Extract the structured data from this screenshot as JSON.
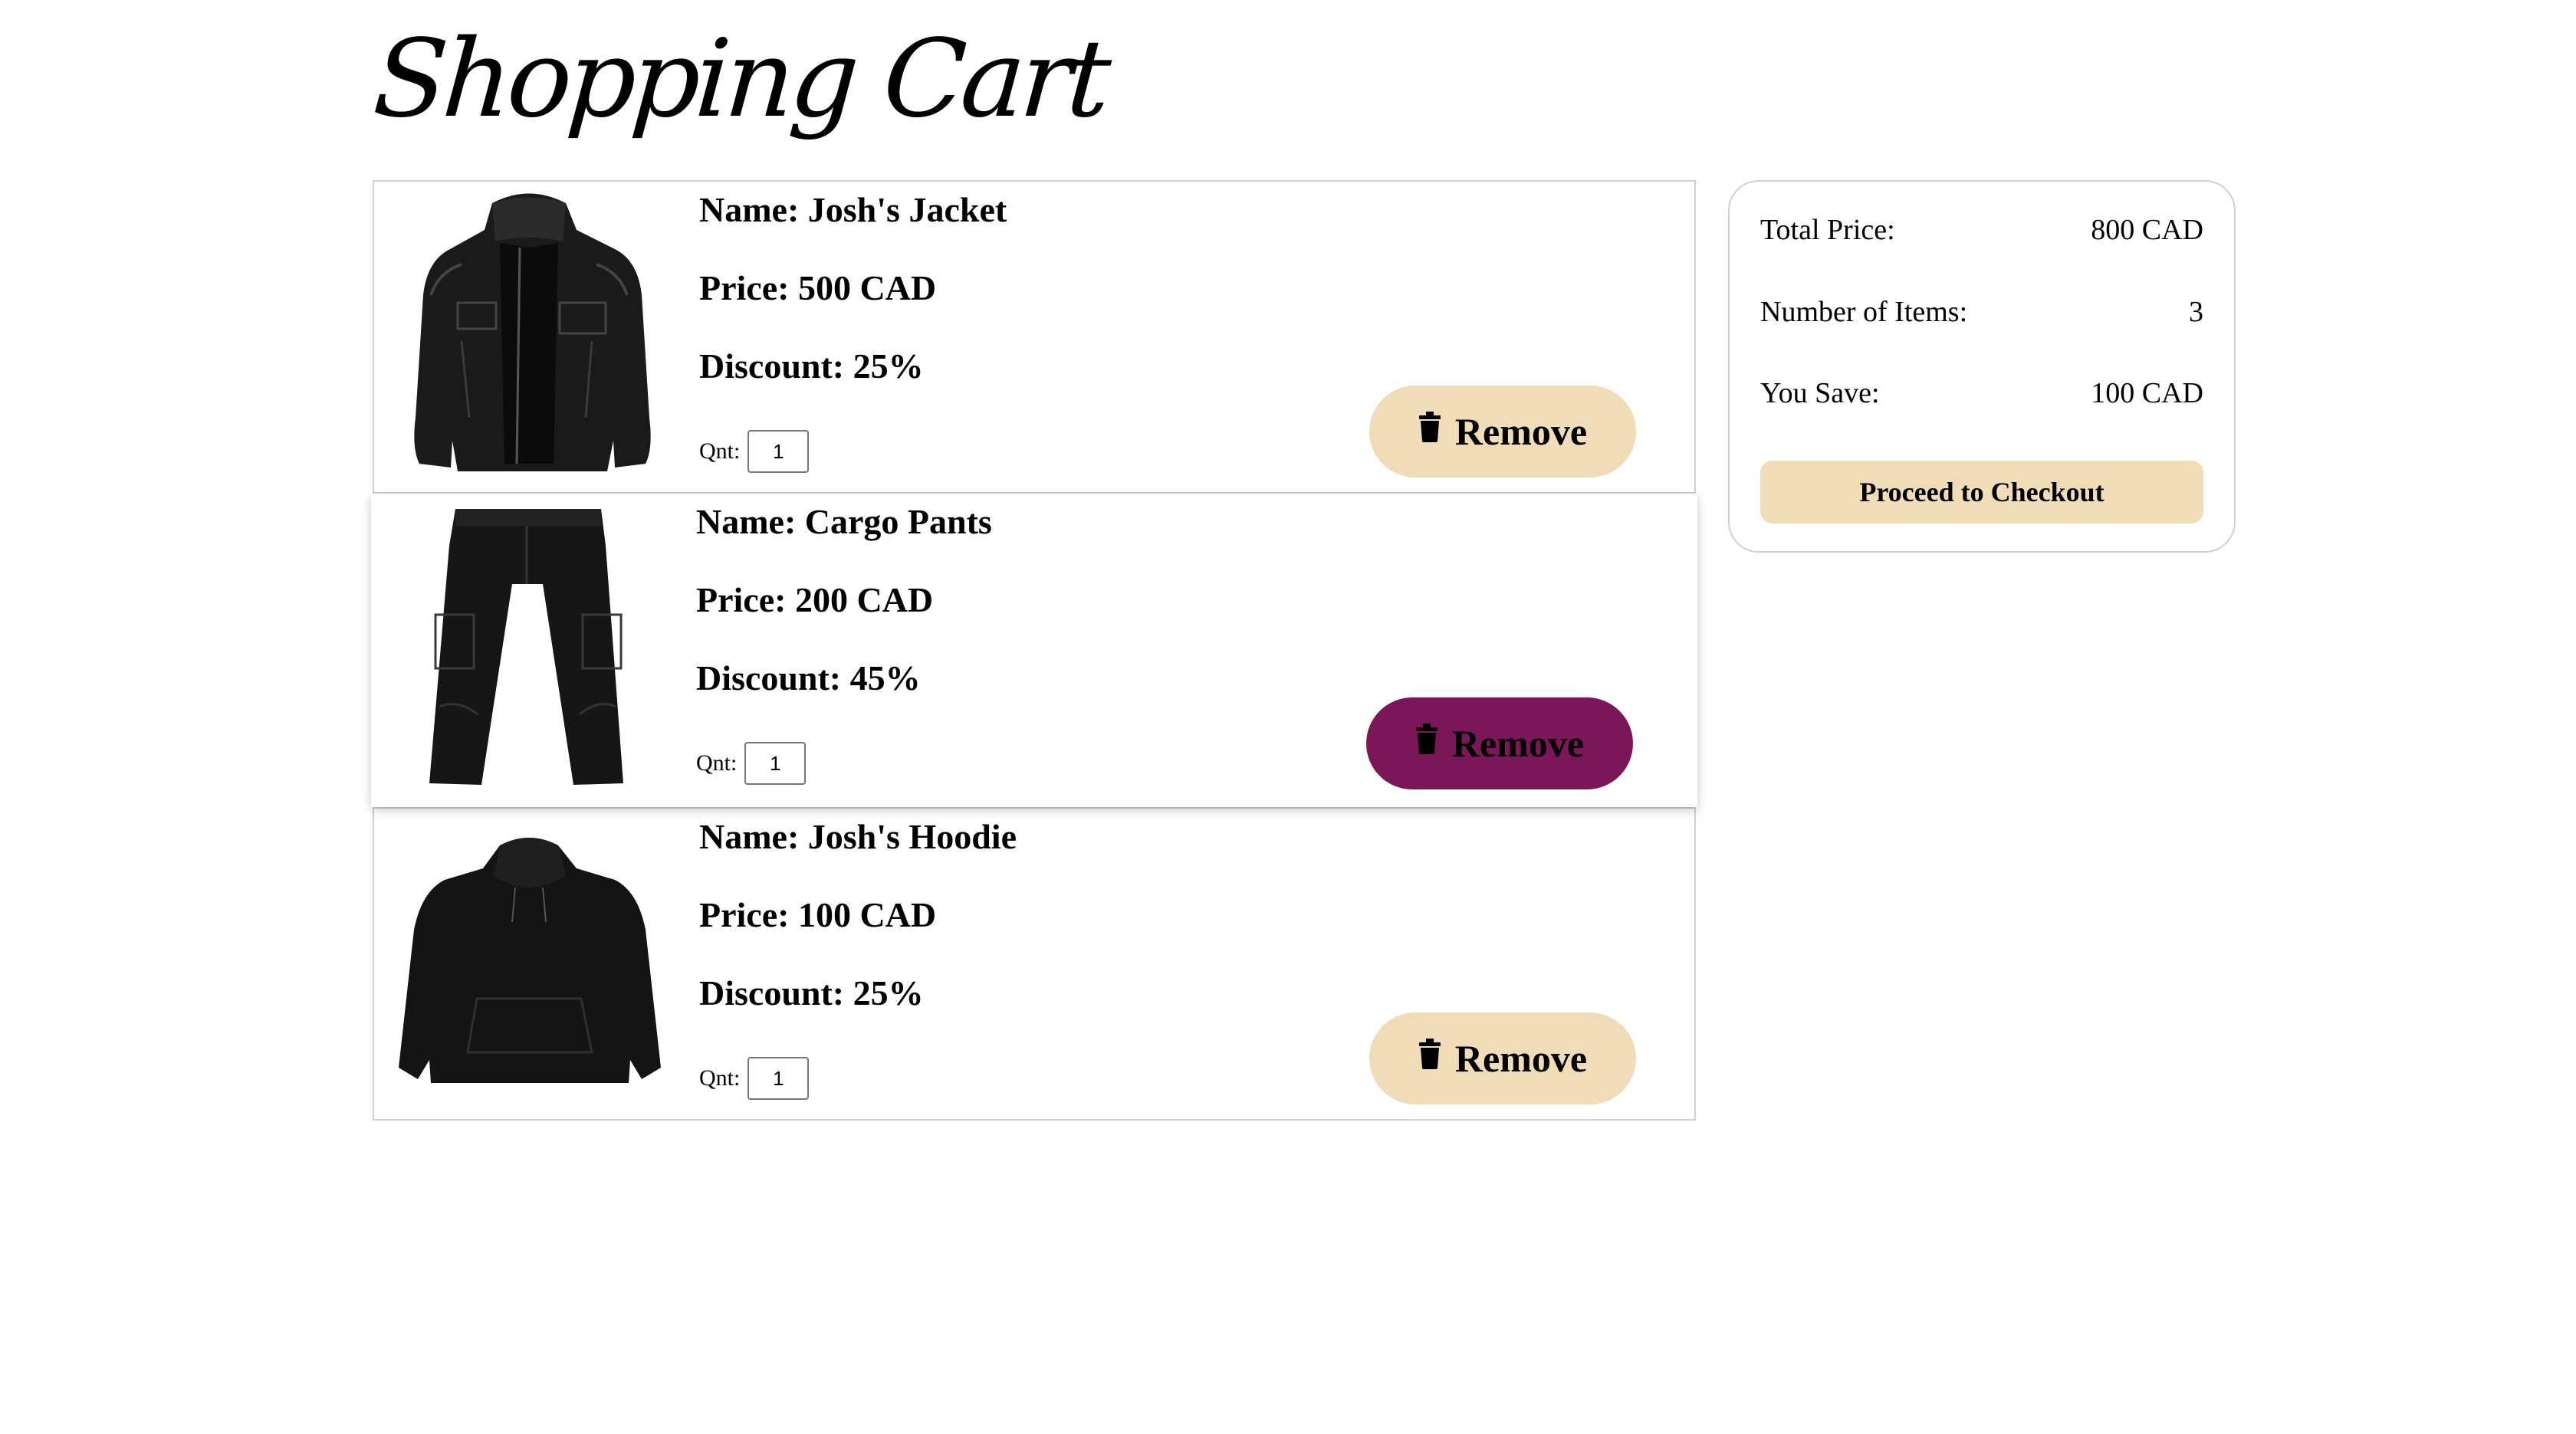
{
  "page": {
    "title": "Shopping Cart"
  },
  "cart": {
    "items": [
      {
        "name": "Name: Josh's Jacket",
        "price": "Price: 500 CAD",
        "discount": "Discount: 25%",
        "qty_label": "Qnt:",
        "qty_value": "1",
        "remove_label": "Remove",
        "image_icon": "leather-jacket-image"
      },
      {
        "name": "Name: Cargo Pants",
        "price": "Price: 200 CAD",
        "discount": "Discount: 45%",
        "qty_label": "Qnt:",
        "qty_value": "1",
        "remove_label": "Remove",
        "image_icon": "cargo-pants-image"
      },
      {
        "name": "Name: Josh's Hoodie",
        "price": "Price: 100 CAD",
        "discount": "Discount: 25%",
        "qty_label": "Qnt:",
        "qty_value": "1",
        "remove_label": "Remove",
        "image_icon": "hoodie-image"
      }
    ]
  },
  "summary": {
    "total_label": "Total Price:",
    "total_value": "800 CAD",
    "count_label": "Number of Items:",
    "count_value": "3",
    "save_label": "You Save:",
    "save_value": "100 CAD",
    "checkout_label": "Proceed to Checkout"
  },
  "colors": {
    "button_default": "#f1dcb8",
    "button_active": "#7b1659",
    "border": "#cfcfcf"
  }
}
